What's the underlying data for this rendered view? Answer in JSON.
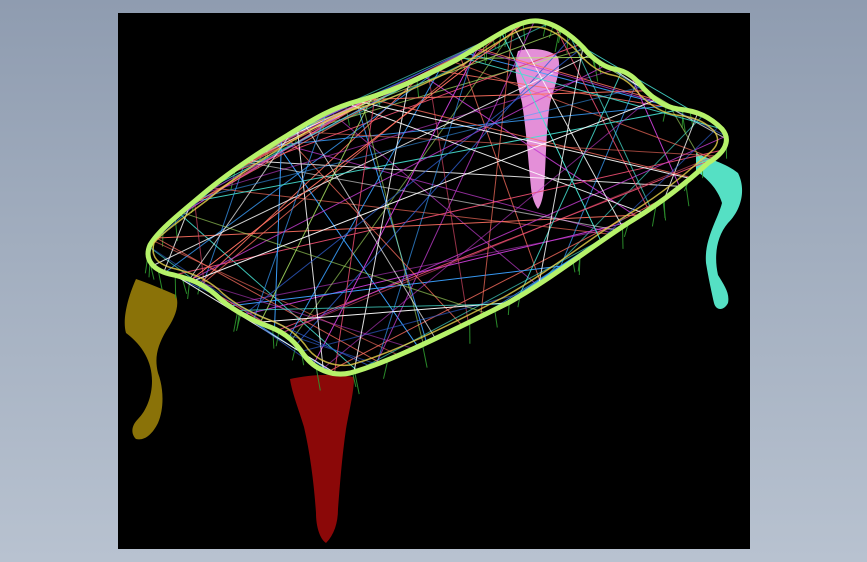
{
  "viewport": {
    "background": "#000000",
    "backdrop_gradient": [
      "#8f9cb0",
      "#b8c2d0"
    ]
  },
  "model": {
    "render_mode": "wireframe",
    "colors": {
      "tabletop_edge": "#b6f26a",
      "apron_mesh": "#2f9a2f",
      "leg_front_left": "#8a7208",
      "leg_front_center": "#8b0808",
      "leg_back_right": "#55e0c4",
      "leg_back_center": "#e48fd8",
      "lines": [
        "#e04a6a",
        "#c43cd0",
        "#3aa0ff",
        "#2f5fd0",
        "#46e0d0",
        "#ff7060",
        "#ffffff",
        "#b6f26a"
      ]
    }
  }
}
